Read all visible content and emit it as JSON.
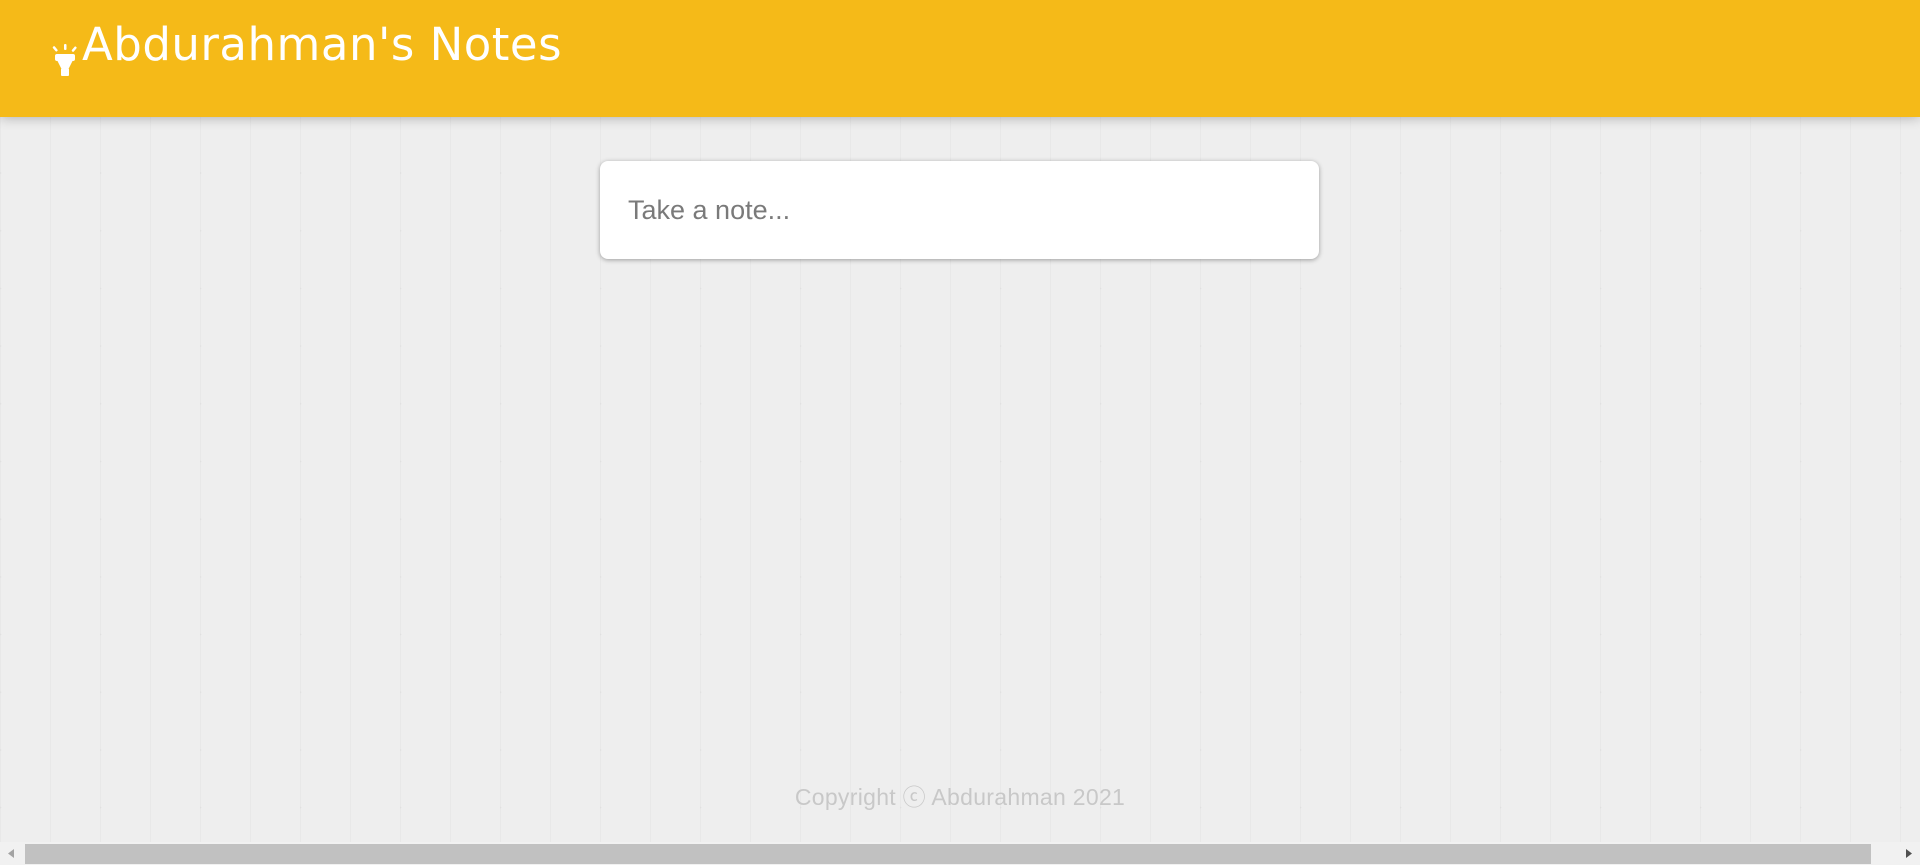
{
  "header": {
    "title": "Abdurahman's Notes",
    "background_color": "#f5ba18",
    "logo_icon": "lightbulb-icon"
  },
  "note_input": {
    "placeholder": "Take a note...",
    "value": ""
  },
  "footer": {
    "text": "Copyright ⓒ Abdurahman 2021"
  },
  "scrollbar": {
    "left_arrow": "scroll-left-arrow-icon",
    "right_arrow": "scroll-right-arrow-icon"
  }
}
